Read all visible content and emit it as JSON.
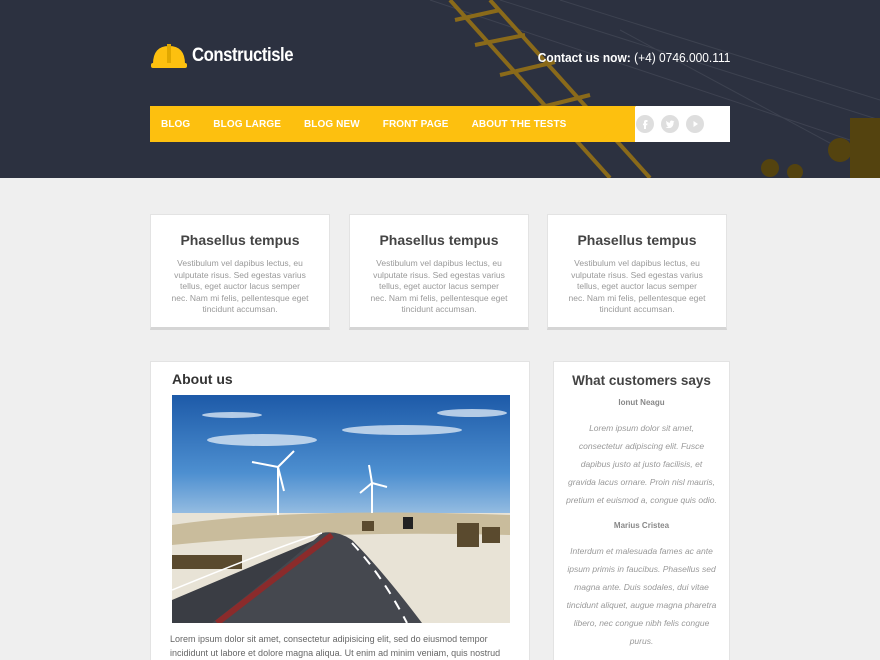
{
  "brand": {
    "name": "Constructisle",
    "logo_icon": "hard-hat-icon",
    "accent": "#fdc00f"
  },
  "contact": {
    "label": "Contact us now:",
    "phone": "(+4) 0746.000.111"
  },
  "nav": {
    "items": [
      "BLOG",
      "BLOG LARGE",
      "BLOG NEW",
      "FRONT PAGE",
      "ABOUT THE TESTS"
    ],
    "social": [
      "facebook-icon",
      "twitter-icon",
      "youtube-icon"
    ]
  },
  "features": [
    {
      "title": "Phasellus tempus",
      "text": "Vestibulum vel dapibus lectus, eu vulputate risus. Sed egestas varius tellus, eget auctor lacus semper nec. Nam mi felis, pellentesque eget tincidunt accumsan."
    },
    {
      "title": "Phasellus tempus",
      "text": "Vestibulum vel dapibus lectus, eu vulputate risus. Sed egestas varius tellus, eget auctor lacus semper nec. Nam mi felis, pellentesque eget tincidunt accumsan."
    },
    {
      "title": "Phasellus tempus",
      "text": "Vestibulum vel dapibus lectus, eu vulputate risus. Sed egestas varius tellus, eget auctor lacus semper nec. Nam mi felis, pellentesque eget tincidunt accumsan."
    }
  ],
  "about": {
    "title": "About us",
    "text": "Lorem ipsum dolor sit amet, consectetur adipisicing elit, sed do eiusmod tempor incididunt ut labore et dolore magna aliqua. Ut enim ad minim veniam, quis nostrud exercitation ullamco"
  },
  "testimonials": {
    "title": "What customers says",
    "items": [
      {
        "name": "Ionut Neagu",
        "quote": "Lorem ipsum dolor sit amet, consectetur adipiscing elit. Fusce dapibus justo at justo facilisis, et gravida lacus ornare. Proin nisl mauris, pretium et euismod a, congue quis odio."
      },
      {
        "name": "Marius Cristea",
        "quote": "Interdum et malesuada fames ac ante ipsum primis in faucibus. Phasellus sed magna ante. Duis sodales, dui vitae tincidunt aliquet, augue magna pharetra libero, nec congue nibh felis congue purus."
      }
    ]
  }
}
